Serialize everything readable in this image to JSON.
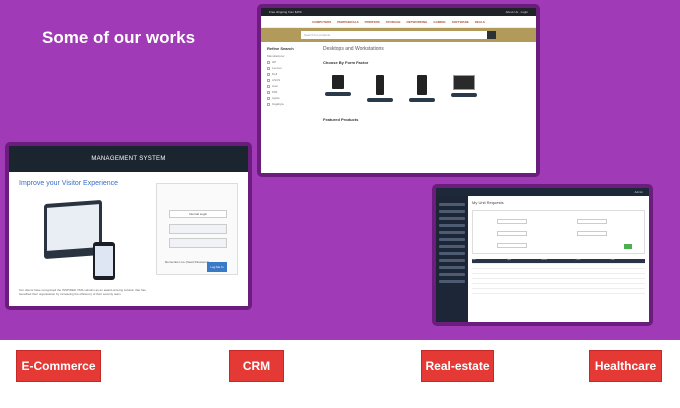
{
  "page": {
    "headline": "Some of our works"
  },
  "colors": {
    "background": "#a13ab6",
    "frame": "#6b1d7d",
    "tag": "#e53935",
    "tag_text": "#ffffff"
  },
  "ecommerce_shot": {
    "topbar_text": "Free shipping from $150",
    "topbar_right": "About Us · Login",
    "nav": [
      "COMPUTERS",
      "PERIPHERALS",
      "PRINTERS",
      "STORAGE",
      "NETWORKING",
      "GAMING",
      "SOFTWARE",
      "DEALS"
    ],
    "search_placeholder": "Search for products",
    "sidebar_title": "Refine Search",
    "filter_group": "Manufacturer",
    "filters": [
      "HP",
      "Lenovo",
      "Dell",
      "ASUS",
      "Acer",
      "MSI",
      "Apple",
      "Gigabyte"
    ],
    "page_heading": "Desktops and Workstations",
    "section_title": "Choose By Form Factor",
    "products": [
      "Small Form Factor",
      "Mini Tower",
      "Tower",
      "All-in-One"
    ],
    "featured": "Featured Products"
  },
  "crm_shot": {
    "header": "MANAGEMENT SYSTEM",
    "subtitle": "Improve your Visitor Experience",
    "login_button": "Internal Login",
    "remember": "Remember me (Need Password)",
    "submit": "Log Me In",
    "body_text": "Our clients have recognised the INSPIRED VMS solution as an award-winning solution that has benefited their organisation by increasing the efficiency of their security team."
  },
  "realestate_shot": {
    "topbar_right": "Admin",
    "page_title": "My Unit Requests",
    "columns": [
      "Unit",
      "Type",
      "Status",
      "Price",
      "Date"
    ]
  },
  "tags": [
    "E-Commerce",
    "CRM",
    "Real-estate",
    "Healthcare"
  ]
}
